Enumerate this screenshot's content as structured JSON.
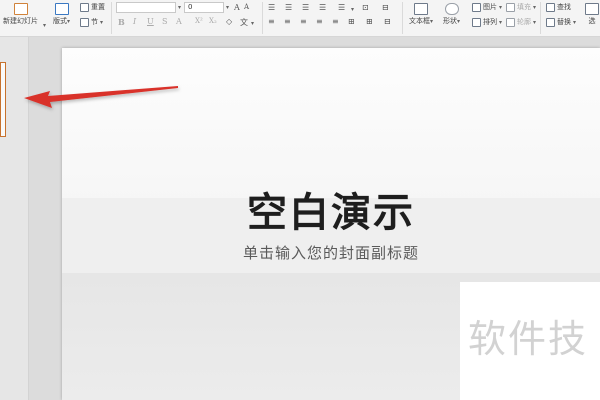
{
  "ribbon": {
    "new_slide": "新建幻灯片",
    "layout": "版式",
    "section": "节",
    "reset": "重置",
    "font_size": "0",
    "text_box": "文本框",
    "shape": "形状",
    "picture": "图片",
    "arrange": "排列",
    "fill": "填充",
    "outline": "轮廓",
    "find": "查找",
    "replace": "替换",
    "select": "选"
  },
  "slide": {
    "title": "空白演示",
    "subtitle": "单击输入您的封面副标题",
    "watermark": "软件技"
  },
  "colors": {
    "arrow": "#d9302a",
    "thumbnail_border": "#c7722e"
  },
  "icons": [
    "new-slide-icon",
    "layout-icon",
    "section-icon",
    "reset-icon",
    "bold-icon",
    "italic-icon",
    "underline-icon",
    "strikethrough-icon",
    "superscript-icon",
    "subscript-icon",
    "clear-format-icon",
    "text-direction-icon",
    "bullet-list-icon",
    "numbered-list-icon",
    "align-left-icon",
    "align-center-icon",
    "align-right-icon",
    "justify-icon",
    "text-box-icon",
    "shape-icon",
    "picture-icon",
    "arrange-icon",
    "fill-icon",
    "outline-icon",
    "find-icon",
    "replace-icon"
  ]
}
